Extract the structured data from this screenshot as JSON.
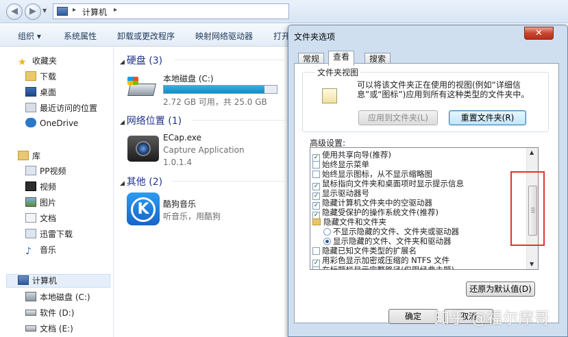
{
  "explorer": {
    "breadcrumb": [
      "计算机"
    ],
    "toolbar": [
      "组织 ▾",
      "系统属性",
      "卸载或更改程序",
      "映射网络驱动器",
      "打开"
    ],
    "nav": {
      "favorites": {
        "label": "收藏夹",
        "items": [
          "下载",
          "桌面",
          "最近访问的位置",
          "OneDrive"
        ]
      },
      "libraries": {
        "label": "库",
        "items": [
          "PP视频",
          "视频",
          "图片",
          "文档",
          "迅雷下载",
          "音乐"
        ]
      },
      "computer": {
        "label": "计算机",
        "items": [
          "本地磁盘 (C:)",
          "软件 (D:)",
          "文档 (E:)"
        ]
      }
    },
    "groups": {
      "hdd": "硬盘 (3)",
      "network": "网络位置 (1)",
      "other": "其他 (2)"
    },
    "drive_c": {
      "name": "本地磁盘 (C:)",
      "space": "2.72 GB 可用，共 25.0 GB",
      "used_fraction": 0.891
    },
    "ecap": {
      "name": "ECap.exe",
      "desc": "Capture Application",
      "version": "1.0.1.4"
    },
    "kugou": {
      "name": "酷狗音乐",
      "desc": "听音乐，用酷狗"
    }
  },
  "dialog": {
    "title": "文件夹选项",
    "close": "✕",
    "tabs": [
      "常规",
      "查看",
      "搜索"
    ],
    "active_tab": 1,
    "folder_views": {
      "legend": "文件夹视图",
      "description": "可以将该文件夹正在使用的视图(例如“详细信息”或“图标”)应用到所有这种类型的文件夹中。",
      "apply_button": "应用到文件夹(L)",
      "reset_button": "重置文件夹(R)"
    },
    "advanced_label": "高级设置:",
    "settings": [
      {
        "kind": "check",
        "checked": true,
        "indent": 0,
        "label": "使用共享向导(推荐)"
      },
      {
        "kind": "check",
        "checked": false,
        "indent": 0,
        "label": "始终显示菜单"
      },
      {
        "kind": "check",
        "checked": false,
        "indent": 0,
        "label": "始终显示图标，从不显示缩略图"
      },
      {
        "kind": "check",
        "checked": true,
        "indent": 0,
        "label": "鼠标指向文件夹和桌面项时显示提示信息"
      },
      {
        "kind": "check",
        "checked": true,
        "indent": 0,
        "label": "显示驱动器号"
      },
      {
        "kind": "check",
        "checked": true,
        "indent": 0,
        "label": "隐藏计算机文件夹中的空驱动器"
      },
      {
        "kind": "check",
        "checked": true,
        "indent": 0,
        "label": "隐藏受保护的操作系统文件(推荐)"
      },
      {
        "kind": "folder",
        "indent": 0,
        "label": "隐藏文件和文件夹"
      },
      {
        "kind": "radio",
        "checked": false,
        "indent": 1,
        "label": "不显示隐藏的文件、文件夹或驱动器"
      },
      {
        "kind": "radio",
        "checked": true,
        "indent": 1,
        "label": "显示隐藏的文件、文件夹和驱动器"
      },
      {
        "kind": "check",
        "checked": false,
        "indent": 0,
        "label": "隐藏已知文件类型的扩展名"
      },
      {
        "kind": "check",
        "checked": true,
        "indent": 0,
        "label": "用彩色显示加密或压缩的 NTFS 文件"
      },
      {
        "kind": "check",
        "checked": false,
        "indent": 0,
        "label": "在标题栏显示完整路径(仅限经典主题)"
      }
    ],
    "restore_button": "还原为默认值(D)",
    "ok_button": "确定",
    "cancel_button": "取消"
  },
  "watermark": "知乎 @福尔摩哥"
}
